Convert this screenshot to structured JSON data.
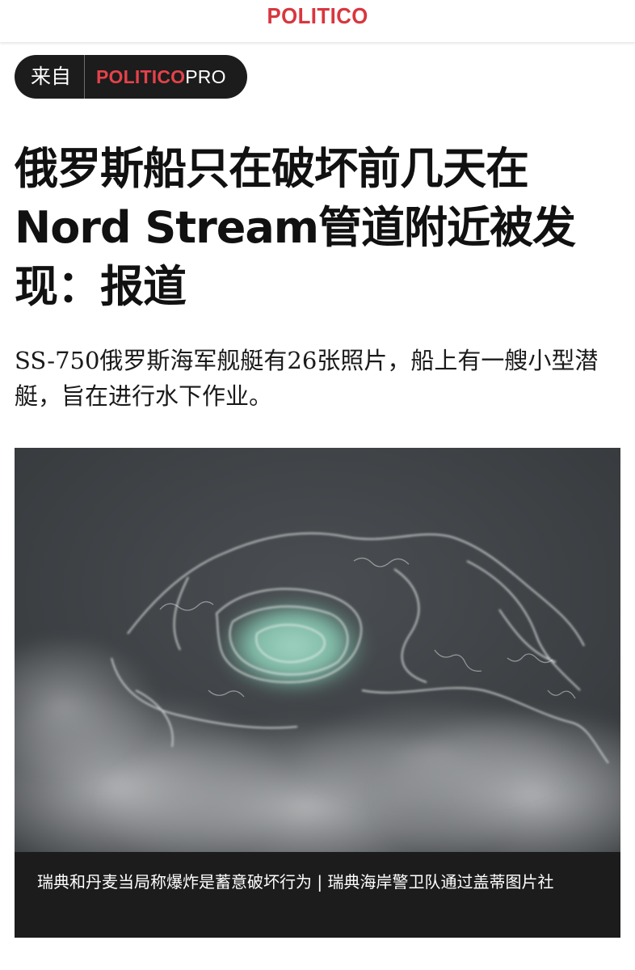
{
  "header": {
    "logo": "POLITICO"
  },
  "source_badge": {
    "label": "来自",
    "brand_main": "POLITICO",
    "brand_suffix": "PRO"
  },
  "article": {
    "headline": "俄罗斯船只在破坏前几天在Nord Stream管道附近被发现：报道",
    "dek": "SS-750俄罗斯海军舰艇有26张照片，船上有一艘小型潜艇，旨在进行水下作业。",
    "image_caption": "瑞典和丹麦当局称爆炸是蓄意破坏行为 | 瑞典海岸警卫队通过盖蒂图片社"
  },
  "colors": {
    "brand_red": "#d9363e",
    "badge_bg": "#1c1c1c",
    "caption_bg": "#1c1c1c"
  }
}
